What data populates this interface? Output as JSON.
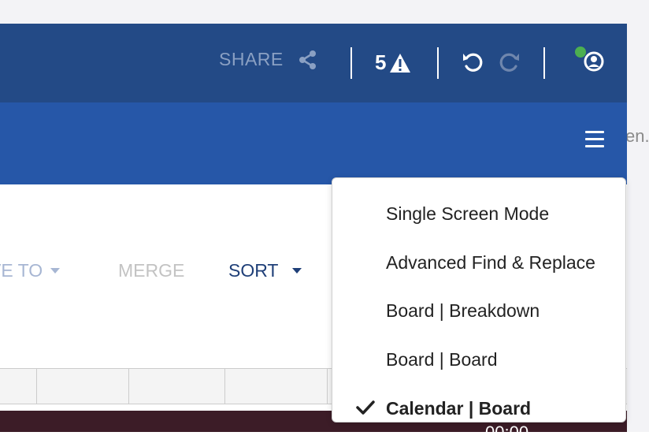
{
  "header": {
    "share_label": "SHARE",
    "alerts_count": "5"
  },
  "gutter": {
    "text": "en."
  },
  "toolbar": {
    "move_to_label": "VE TO",
    "merge_label": "MERGE",
    "sort_label": "SORT"
  },
  "menu": {
    "items": [
      {
        "label": "Single Screen Mode"
      },
      {
        "label": "Advanced Find & Replace"
      },
      {
        "label": "Board | Breakdown"
      },
      {
        "label": "Board | Board"
      },
      {
        "label": "Calendar | Board"
      }
    ],
    "selected_label": "Calendar | Board"
  },
  "status": {
    "time": "00:00"
  },
  "colors": {
    "header_dark": "#234a86",
    "header_blue": "#2657a8",
    "status_online": "#4caf50"
  },
  "icons": [
    "share-icon",
    "warning-icon",
    "undo-icon",
    "redo-icon",
    "user-icon",
    "hamburger-icon",
    "checkmark-icon"
  ]
}
